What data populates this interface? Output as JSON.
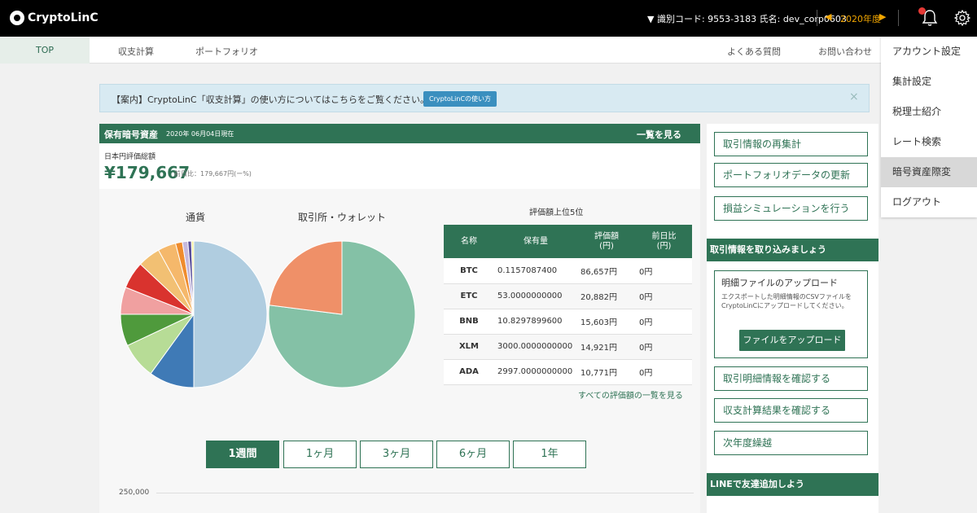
{
  "app": {
    "name": "CryptoLinC"
  },
  "topbar": {
    "user_info": "▼ 識別コード: 9553-3183 氏名: dev_corp0603",
    "year": "2020年度",
    "prev_arrow": "◀",
    "next_arrow": "▶",
    "colors": {
      "accent": "#f0a500",
      "badge": "#e53935"
    }
  },
  "nav": {
    "top": "TOP",
    "calc": "収支計算",
    "portfolio": "ポートフォリオ",
    "faq": "よくある質問",
    "contact": "お問い合わせ"
  },
  "dropdown": {
    "items": [
      "アカウント設定",
      "集計設定",
      "税理士紹介",
      "レート検索",
      "暗号資産際変",
      "ログアウト"
    ]
  },
  "banner": {
    "text": "【案内】CryptoLinC「収支計算」の使い方についてはこちらをご覧ください。",
    "button": "CryptoLinCの使い方",
    "close": "×"
  },
  "holdings": {
    "title": "保有暗号資産",
    "date": "2020年 06月04日現在",
    "view_all": "一覧を見る",
    "jpy_label": "日本円評価総額",
    "jpy_value": "¥179,667",
    "jpy_diff": "前日比：179,667円(ー%)"
  },
  "charts": {
    "currency_title": "通貨",
    "exchange_title": "取引所・ウォレット"
  },
  "chart_data": [
    {
      "type": "pie",
      "title": "通貨",
      "values": [
        50,
        10,
        8,
        7,
        6,
        6,
        5,
        4,
        1.5,
        1.2,
        0.8,
        0.5
      ],
      "colors": [
        "#b0cde0",
        "#3f7ab6",
        "#b7dc96",
        "#4f9a3c",
        "#f0a0a0",
        "#d9332e",
        "#f2c073",
        "#f5b86b",
        "#ef8c2e",
        "#c6b9dd",
        "#5a4f9b",
        "#f5f0a0"
      ]
    },
    {
      "type": "pie",
      "title": "取引所・ウォレット",
      "values": [
        77,
        23
      ],
      "colors": [
        "#84c1a6",
        "#ef9068"
      ]
    }
  ],
  "ranking": {
    "title": "評価額上位5位",
    "headers": {
      "name": "名称",
      "qty": "保有量",
      "value": "評価額\n(円)",
      "diff": "前日比\n(円)"
    },
    "rows": [
      {
        "name": "BTC",
        "qty": "0.1157087400",
        "value": "86,657円",
        "diff": "0円"
      },
      {
        "name": "ETC",
        "qty": "53.0000000000",
        "value": "20,882円",
        "diff": "0円"
      },
      {
        "name": "BNB",
        "qty": "10.8297899600",
        "value": "15,603円",
        "diff": "0円"
      },
      {
        "name": "XLM",
        "qty": "3000.0000000000",
        "value": "14,921円",
        "diff": "0円"
      },
      {
        "name": "ADA",
        "qty": "2997.0000000000",
        "value": "10,771円",
        "diff": "0円"
      }
    ],
    "all_link": "すべての評価額の一覧を見る"
  },
  "periods": {
    "week": "1週間",
    "month1": "1ヶ月",
    "month3": "3ヶ月",
    "month6": "6ヶ月",
    "year1": "1年"
  },
  "line_axis": {
    "tick": "250,000"
  },
  "sidebar": {
    "recalc": "取引情報の再集計",
    "update_portfolio": "ポートフォリオデータの更新",
    "simulation": "損益シミュレーションを行う",
    "import_header": "取引情報を取り込みましょう",
    "upload_title": "明細ファイルのアップロード",
    "upload_desc": "エクスポートした明細情報のCSVファイルをCryptoLinCにアップロードしてください。",
    "upload_button": "ファイルをアップロード",
    "check_details": "取引明細情報を確認する",
    "check_results": "収支計算結果を確認する",
    "carryover": "次年度繰越",
    "line_header": "LINEで友達追加しよう"
  }
}
